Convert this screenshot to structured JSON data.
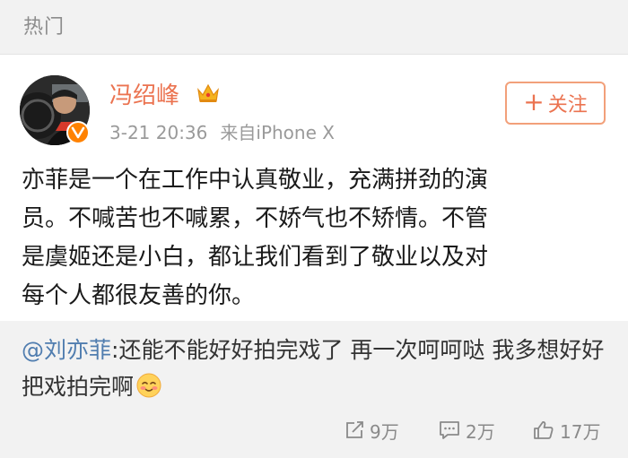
{
  "section": {
    "title": "热门"
  },
  "post": {
    "author": "冯绍峰",
    "timestamp": "3-21 20:36",
    "source": "来自iPhone X",
    "follow_label": "关注",
    "follow_symbol": "+",
    "text": "亦菲是一个在工作中认真敬业，充满拼劲的演\n员。不喊苦也不喊累，不娇气也不矫情。不管\n是虞姬还是小白，都让我们看到了敬业以及对\n每个人都很友善的你。"
  },
  "repost": {
    "mention": "@刘亦菲",
    "text": ":还能不能好好拍完戏了 再一次呵呵哒 我多想好好把戏拍完啊",
    "emoji": "blush-emoji"
  },
  "actions": {
    "repost_count": "9万",
    "comment_count": "2万",
    "like_count": "17万"
  },
  "colors": {
    "accent": "#eb7350",
    "mention": "#507daf",
    "badge": "#ff8200",
    "muted": "#9a9a9a"
  },
  "icons": [
    "crown-icon",
    "verified-badge-icon",
    "repost-icon",
    "comment-icon",
    "like-icon"
  ]
}
